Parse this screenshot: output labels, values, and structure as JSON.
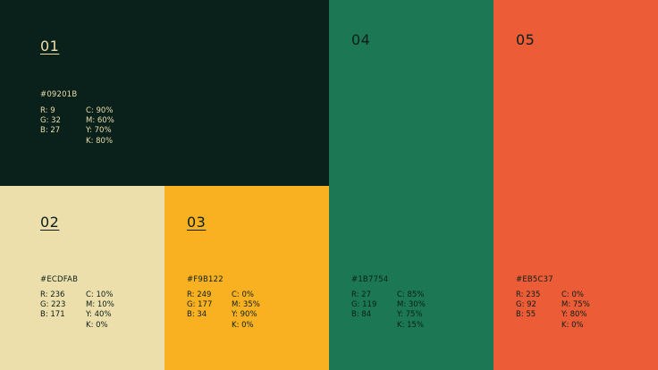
{
  "swatches": [
    {
      "number": "01",
      "hex": "#09201B",
      "color": "#09201B",
      "rgb": [
        "R:  9",
        "G:  32",
        "B:  27"
      ],
      "cmyk": [
        "C:  90%",
        "M:  60%",
        "Y:  70%",
        "K:  80%"
      ]
    },
    {
      "number": "02",
      "hex": "#ECDFAB",
      "color": "#ECDFAB",
      "rgb": [
        "R:  236",
        "G:  223",
        "B:  171"
      ],
      "cmyk": [
        "C:  10%",
        "M:  10%",
        "Y:  40%",
        "K:  0%"
      ]
    },
    {
      "number": "03",
      "hex": "#F9B122",
      "color": "#F9B122",
      "rgb": [
        "R:  249",
        "G:  177",
        "B:  34"
      ],
      "cmyk": [
        "C:  0%",
        "M:  35%",
        "Y:  90%",
        "K:  0%"
      ]
    },
    {
      "number": "04",
      "hex": "#1B7754",
      "color": "#1B7754",
      "rgb": [
        "R:  27",
        "G:  119",
        "B:  84"
      ],
      "cmyk": [
        "C:  85%",
        "M:  30%",
        "Y:  75%",
        "K:  15%"
      ]
    },
    {
      "number": "05",
      "hex": "#EB5C37",
      "color": "#EB5C37",
      "rgb": [
        "R:  235",
        "G:  92",
        "B:  55"
      ],
      "cmyk": [
        "C:  0%",
        "M:  75%",
        "Y:  80%",
        "K:  0%"
      ]
    }
  ]
}
